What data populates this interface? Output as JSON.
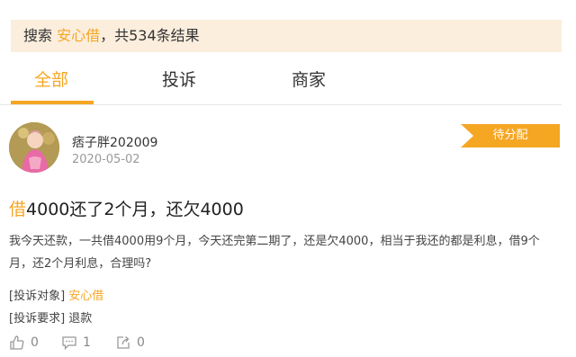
{
  "search": {
    "prefix": "搜索",
    "keyword": "安心借",
    "suffix": "，共534条结果"
  },
  "tabs": [
    {
      "label": "全部",
      "active": true
    },
    {
      "label": "投诉",
      "active": false
    },
    {
      "label": "商家",
      "active": false
    }
  ],
  "post": {
    "username": "痞子胖202009",
    "date": "2020-05-02",
    "status": "待分配",
    "title_first_char": "借",
    "title_rest": "4000还了2个月，还欠4000",
    "body": "我今天还款，一共借4000用9个月，今天还完第二期了，还是欠4000，相当于我还的都是利息，借9个月，还2个月利息，合理吗?",
    "complaint_target_label": "[投诉对象]",
    "complaint_target_value": "安心借",
    "complaint_request_label": "[投诉要求]",
    "complaint_request_value": "退款",
    "likes": "0",
    "comments": "1",
    "shares": "0"
  },
  "colors": {
    "accent": "#f5a623",
    "banner_bg": "#fbeedd"
  },
  "icons": {
    "like": "thumbs-up-icon",
    "comment": "comment-icon",
    "share": "share-icon"
  }
}
